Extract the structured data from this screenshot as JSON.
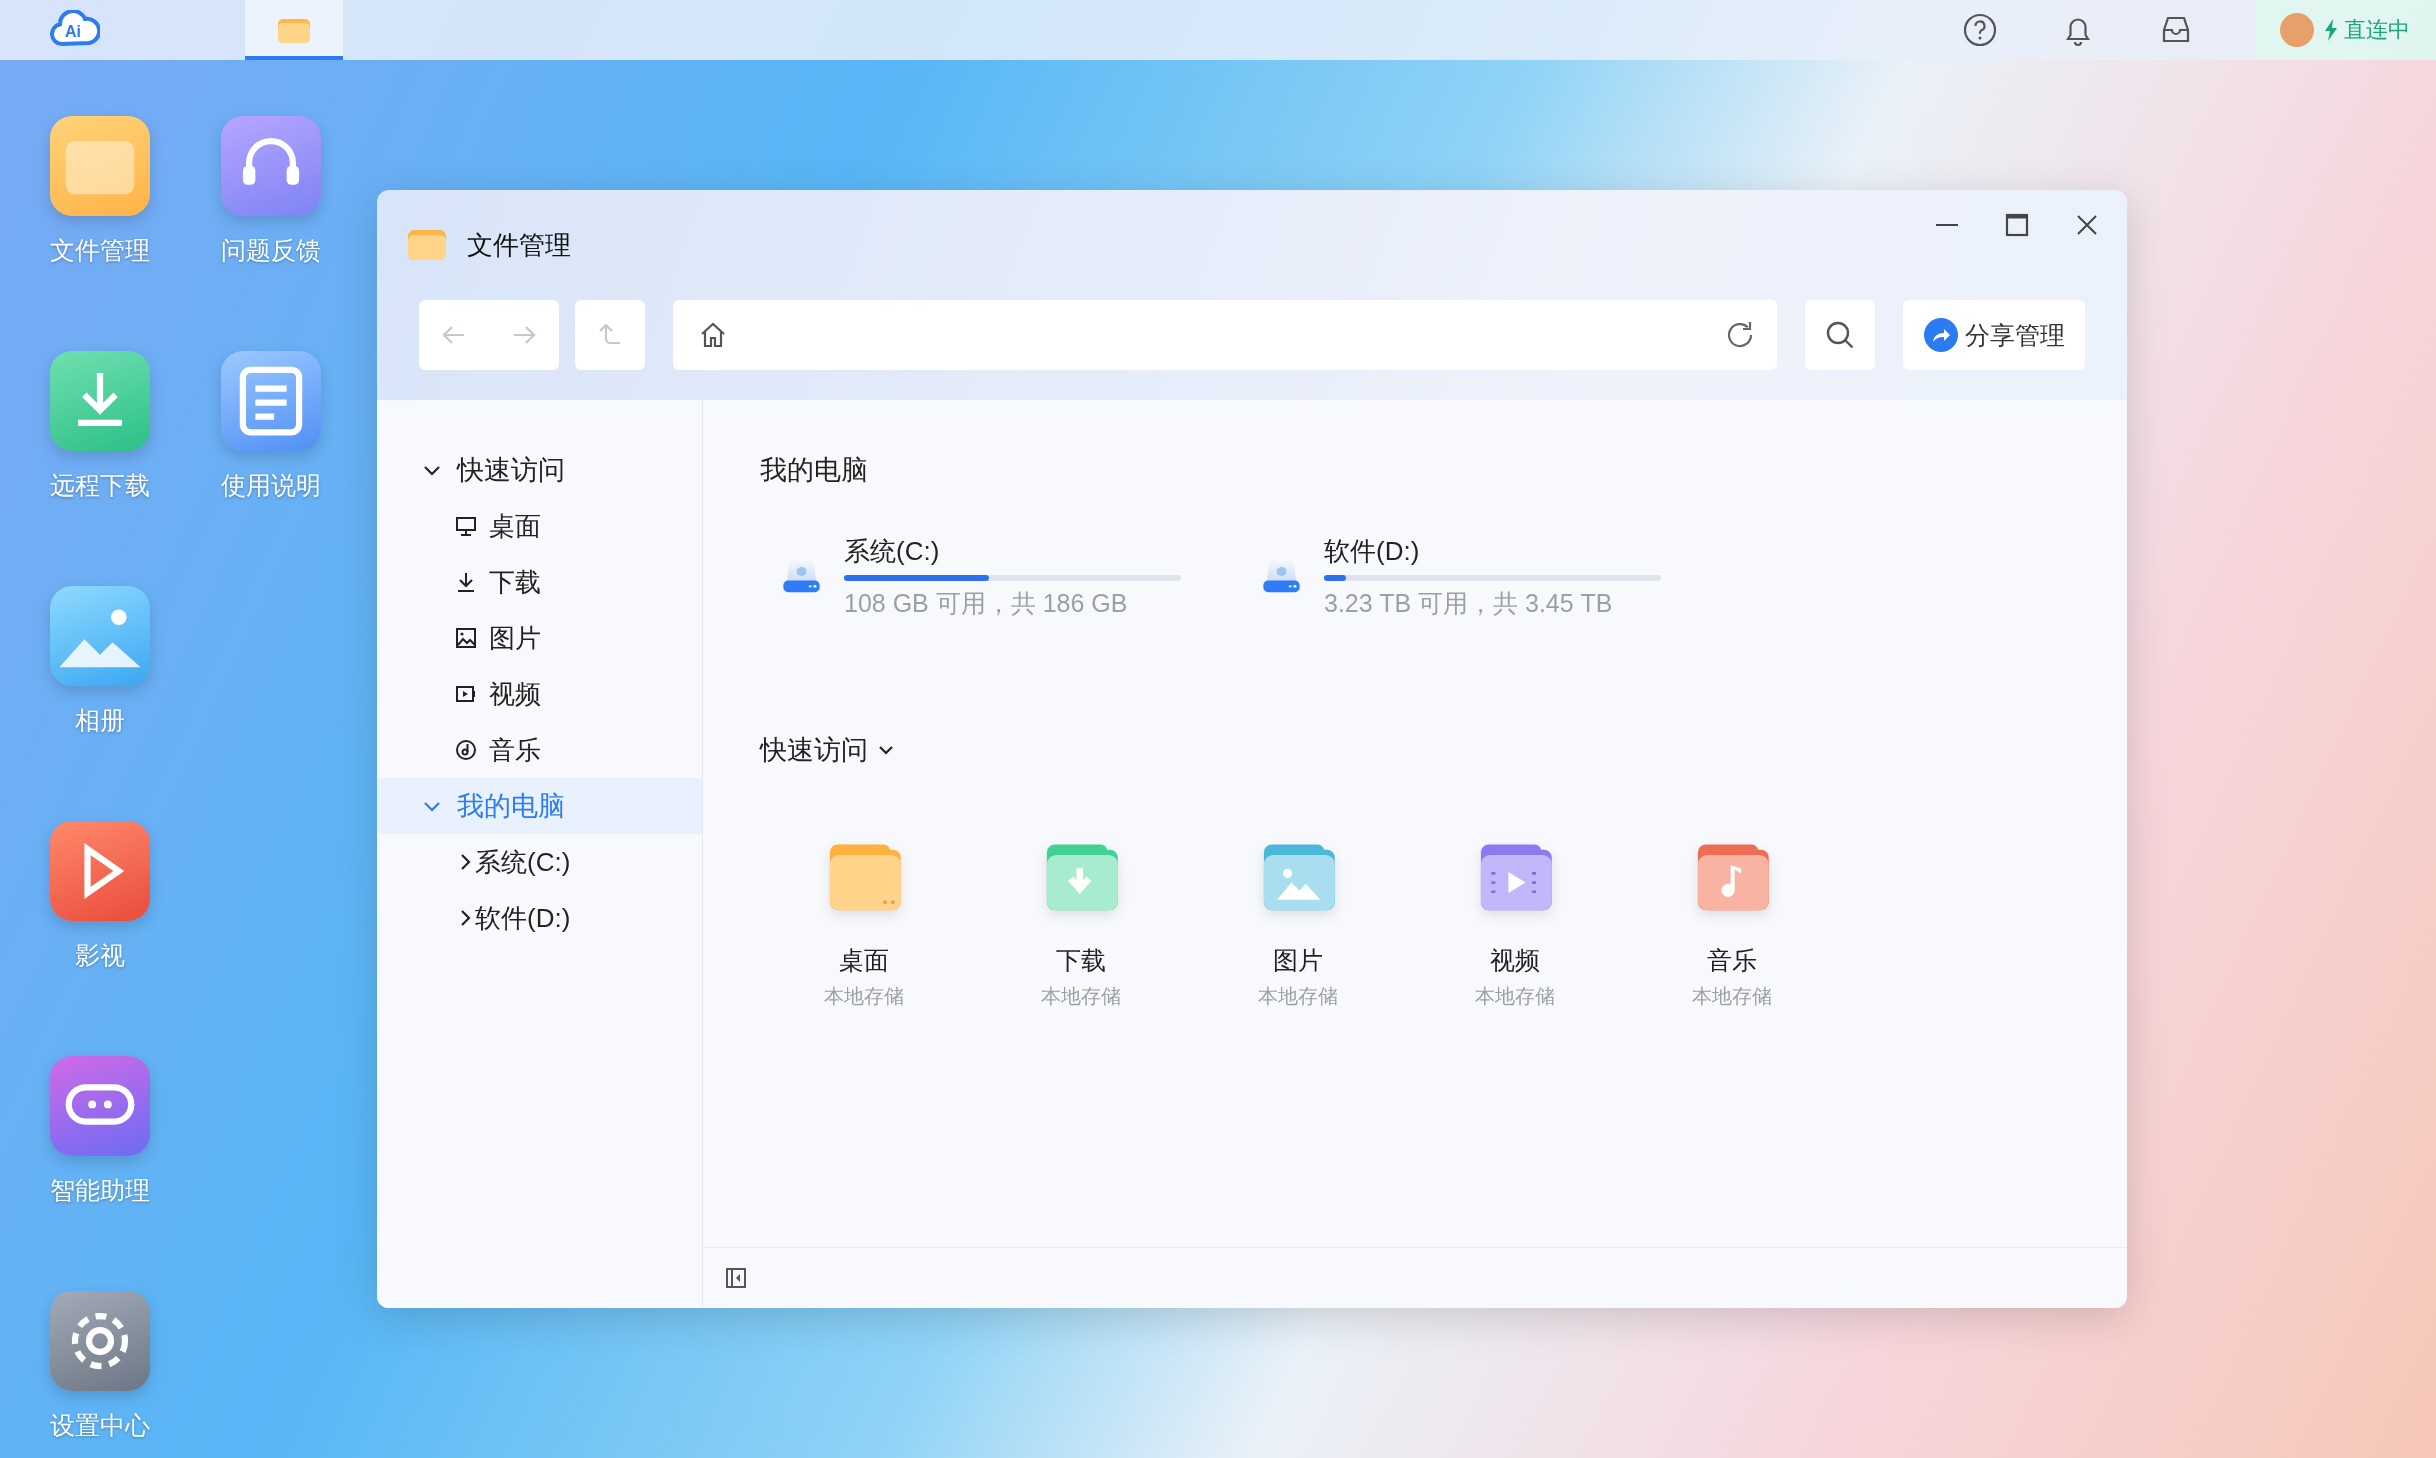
{
  "top_bar": {
    "logo_text": "Ai",
    "tabs": [
      {
        "kind": "folder",
        "selected": true
      }
    ],
    "status": "直连中"
  },
  "desktop_columns": [
    [
      {
        "label": "文件管理",
        "kind": "folder"
      },
      {
        "label": "远程下载",
        "kind": "download"
      },
      {
        "label": "相册",
        "kind": "album"
      },
      {
        "label": "影视",
        "kind": "video"
      },
      {
        "label": "智能助理",
        "kind": "assistant"
      },
      {
        "label": "设置中心",
        "kind": "settings"
      }
    ],
    [
      {
        "label": "问题反馈",
        "kind": "feedback"
      },
      {
        "label": "使用说明",
        "kind": "manual"
      }
    ]
  ],
  "window": {
    "title": "文件管理",
    "share_button": "分享管理",
    "sidebar": [
      {
        "label": "快速访问",
        "expanded": true,
        "selected": false,
        "children": [
          {
            "label": "桌面",
            "kind": "desktop"
          },
          {
            "label": "下载",
            "kind": "download"
          },
          {
            "label": "图片",
            "kind": "picture"
          },
          {
            "label": "视频",
            "kind": "video"
          },
          {
            "label": "音乐",
            "kind": "music"
          }
        ]
      },
      {
        "label": "我的电脑",
        "expanded": true,
        "selected": true,
        "children": [
          {
            "label": "系统(C:)",
            "kind": "drive"
          },
          {
            "label": "软件(D:)",
            "kind": "drive"
          }
        ]
      }
    ],
    "computer": {
      "heading": "我的电脑",
      "drives": [
        {
          "name": "系统(C:)",
          "level": 0.43,
          "info": "108 GB 可用，共 186 GB"
        },
        {
          "name": "软件(D:)",
          "level": 0.065,
          "info": "3.23 TB 可用，共 3.45 TB"
        }
      ]
    },
    "quick_access": {
      "heading": "快速访问",
      "items": [
        {
          "label": "桌面",
          "sub": "本地存储",
          "kind": "desktop"
        },
        {
          "label": "下载",
          "sub": "本地存储",
          "kind": "download"
        },
        {
          "label": "图片",
          "sub": "本地存储",
          "kind": "picture"
        },
        {
          "label": "视频",
          "sub": "本地存储",
          "kind": "video"
        },
        {
          "label": "音乐",
          "sub": "本地存储",
          "kind": "music"
        }
      ]
    }
  }
}
